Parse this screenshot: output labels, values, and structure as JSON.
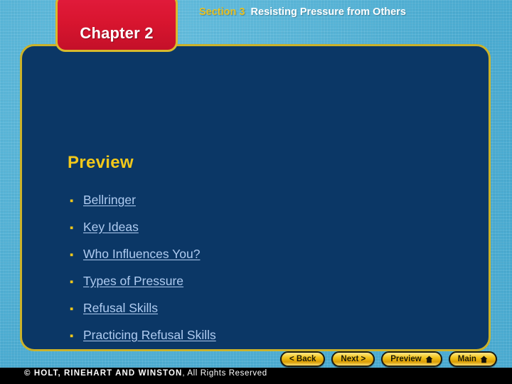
{
  "header": {
    "chapter_label": "Chapter 2",
    "section_number": "Section 3",
    "section_title": "Resisting Pressure from Others"
  },
  "main": {
    "preview_heading": "Preview",
    "links": [
      {
        "label": "Bellringer"
      },
      {
        "label": "Key Ideas"
      },
      {
        "label": "Who Influences You?"
      },
      {
        "label": "Types of Pressure"
      },
      {
        "label": "Refusal Skills"
      },
      {
        "label": "Practicing Refusal Skills"
      }
    ],
    "bullet_glyph": "▪"
  },
  "nav": {
    "back_label": "< Back",
    "next_label": "Next >",
    "preview_label": "Preview",
    "main_label": "Main"
  },
  "footer": {
    "copyright_bold": "© HOLT, RINEHART AND WINSTON",
    "copyright_rest": ", All Rights Reserved"
  },
  "colors": {
    "background_blue": "#4FB9E2",
    "panel_navy": "#0B3766",
    "panel_border_gold": "#CBB22A",
    "chapter_red": "#D8152F",
    "heading_gold": "#F2C81A",
    "link_blue": "#AFCBF0",
    "button_gold": "#F2C41A",
    "footer_black": "#000000"
  }
}
